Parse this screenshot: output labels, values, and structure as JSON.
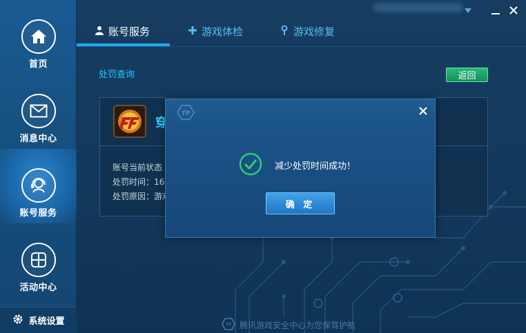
{
  "sidebar": {
    "items": [
      {
        "label": "首页",
        "icon": "home-icon"
      },
      {
        "label": "消息中心",
        "icon": "mail-icon"
      },
      {
        "label": "账号服务",
        "icon": "headset-icon",
        "active": true
      },
      {
        "label": "活动中心",
        "icon": "grid-icon"
      }
    ],
    "settings_label": "系统设置"
  },
  "tabs": [
    {
      "label": "账号服务",
      "icon": "user-icon",
      "active": true
    },
    {
      "label": "游戏体检",
      "icon": "plus-icon"
    },
    {
      "label": "游戏修复",
      "icon": "wrench-icon"
    }
  ],
  "page": {
    "section_title": "处罚查询",
    "back_label": "返回"
  },
  "panel": {
    "game_name": "穿",
    "rows": [
      "账号当前状态",
      "处罚时间：16",
      "处罚原因：游戏"
    ]
  },
  "dialog": {
    "message": "减少处罚时间成功！",
    "confirm_label": "确 定"
  },
  "footer": {
    "text": "腾讯游戏安全中心为您保驾护航"
  },
  "colors": {
    "accent": "#1da8f0",
    "success": "#2ecc71",
    "back_button": "#1fa56b"
  }
}
